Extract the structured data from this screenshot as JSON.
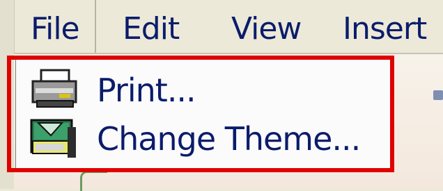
{
  "menubar": {
    "items": [
      {
        "label": "File"
      },
      {
        "label": "Edit"
      },
      {
        "label": "View"
      },
      {
        "label": "Insert"
      }
    ]
  },
  "dropdown": {
    "items": [
      {
        "label": "Print...",
        "icon": "printer-icon"
      },
      {
        "label": "Change Theme...",
        "icon": "theme-icon"
      }
    ]
  },
  "colors": {
    "menu_text": "#0b1c6b",
    "highlight_border": "#e00000"
  }
}
